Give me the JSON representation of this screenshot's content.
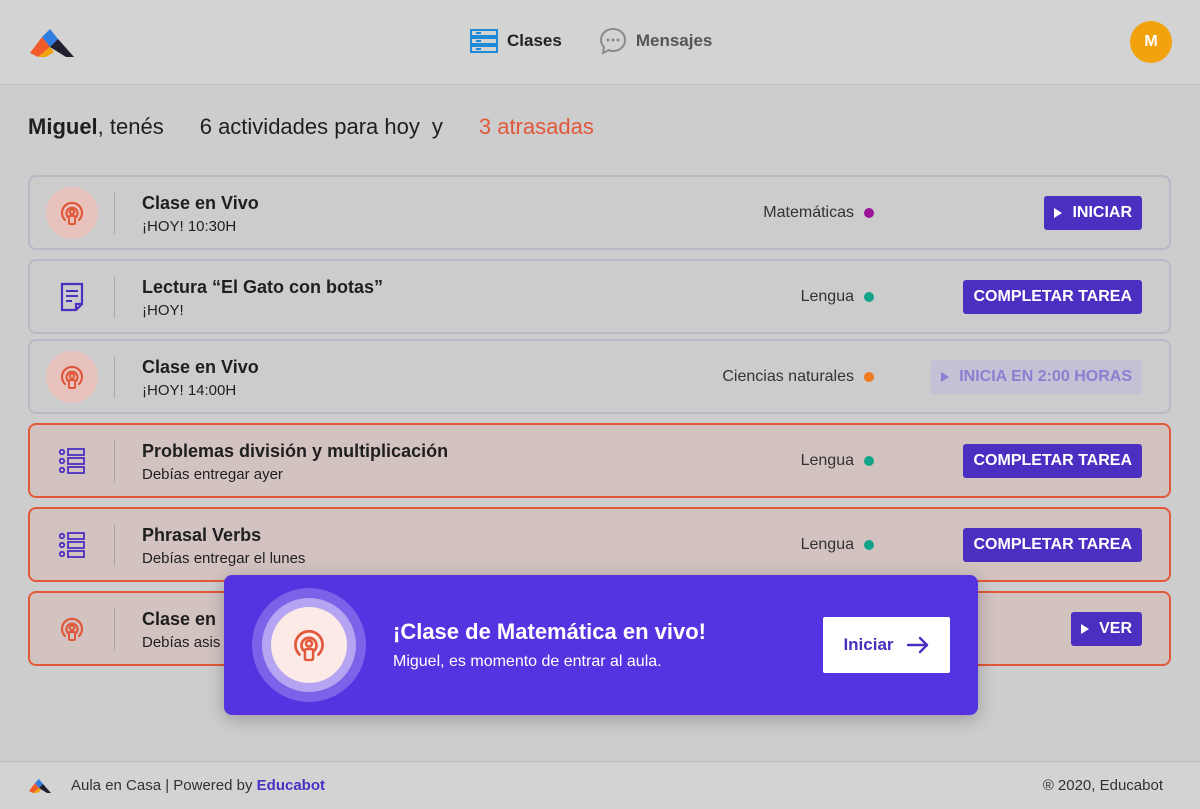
{
  "header": {
    "nav": [
      {
        "label": "Clases",
        "active": true,
        "icon": "classes-icon"
      },
      {
        "label": "Mensajes",
        "active": false,
        "icon": "chat-bubble-icon"
      }
    ],
    "avatar_initial": "M"
  },
  "greeting": {
    "name": "Miguel",
    "tenes": ", tenés",
    "count": "6 actividades para hoy",
    "y": "y",
    "late": "3 atrasadas"
  },
  "activities": [
    {
      "title": "Clase en Vivo",
      "sub": "¡HOY! 10:30H",
      "subject": "Matemáticas",
      "dot_color": "#9b159b",
      "button": "INICIAR",
      "icon": "live-broadcast-icon",
      "late": false,
      "disabled": false
    },
    {
      "title": "Lectura “El Gato con botas”",
      "sub": "¡HOY!",
      "subject": "Lengua",
      "dot_color": "#13a38a",
      "button": "COMPLETAR TAREA",
      "icon": "document-icon",
      "late": false,
      "disabled": false
    },
    {
      "title": "Clase en Vivo",
      "sub": "¡HOY! 14:00H",
      "subject": "Ciencias naturales",
      "dot_color": "#f07a20",
      "button": "INICIA EN 2:00 HORAS",
      "icon": "live-broadcast-icon",
      "late": false,
      "disabled": true
    },
    {
      "title": "Problemas división y multiplicación",
      "sub": "Debías entregar ayer",
      "subject": "Lengua",
      "dot_color": "#13a38a",
      "button": "COMPLETAR TAREA",
      "icon": "list-icon",
      "late": true,
      "disabled": false
    },
    {
      "title": "Phrasal Verbs",
      "sub": "Debías entregar el lunes",
      "subject": "Lengua",
      "dot_color": "#13a38a",
      "button": "COMPLETAR TAREA",
      "icon": "list-icon",
      "late": true,
      "disabled": false
    },
    {
      "title": "Clase en",
      "sub": "Debías asis",
      "subject": "",
      "dot_color": "",
      "button": "VER",
      "icon": "live-broadcast-icon",
      "late": true,
      "disabled": false
    }
  ],
  "modal": {
    "title": "¡Clase de Matemática en vivo!",
    "subtitle": "Miguel, es momento de entrar al aula.",
    "button": "Iniciar"
  },
  "footer": {
    "text": "Aula en Casa | Powered by ",
    "brand": "Educabot",
    "copyright": "® 2020, Educabot"
  },
  "colors": {
    "accent": "#4b2fc0",
    "late": "#e2583a",
    "avatar": "#f2a20c",
    "modal": "#5633e0"
  }
}
